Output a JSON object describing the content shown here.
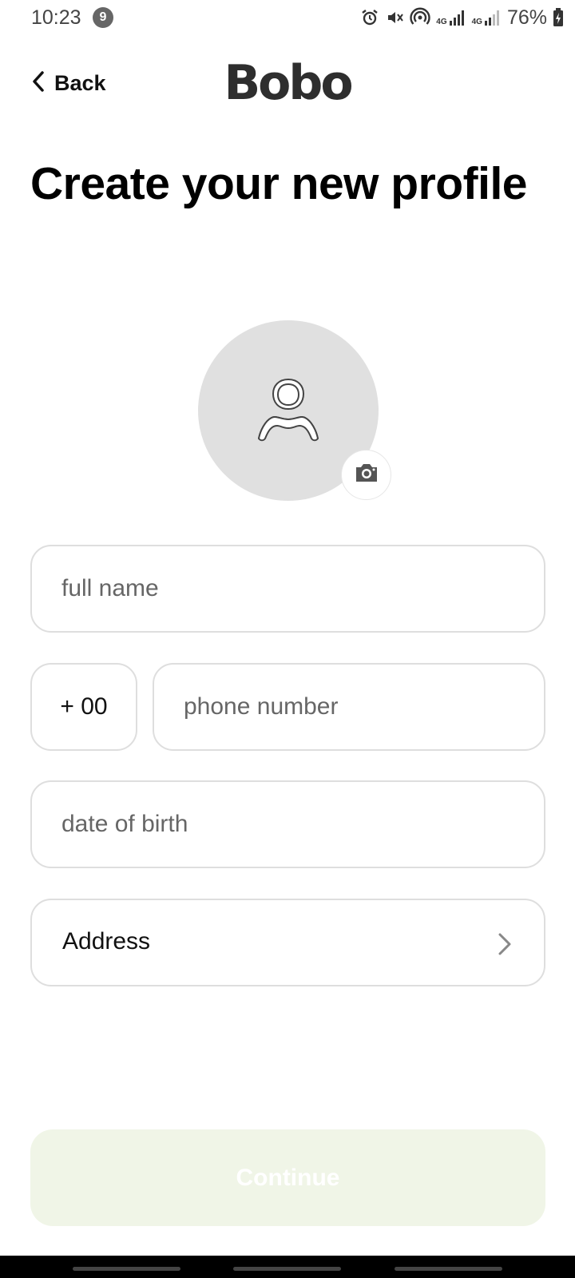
{
  "status_bar": {
    "time": "10:23",
    "notification_count": "9",
    "network_1": "4G",
    "network_2": "4G",
    "battery": "76%",
    "icons": [
      "alarm-icon",
      "vibrate-mute-icon",
      "hotspot-icon",
      "signal-icon",
      "signal-icon",
      "battery-charging-icon"
    ]
  },
  "header": {
    "back_label": "Back",
    "logo": "Bobo"
  },
  "title": "Create your new profile",
  "avatar": {
    "icon": "person-icon",
    "camera_icon": "camera-icon"
  },
  "form": {
    "full_name": {
      "value": "",
      "placeholder": "full name"
    },
    "country_code": "+ 00",
    "phone": {
      "value": "",
      "placeholder": "phone number"
    },
    "date_of_birth": {
      "value": "",
      "placeholder": "date of birth"
    },
    "address_label": "Address"
  },
  "continue_label": "Continue",
  "colors": {
    "continue_bg": "#f0f5e7",
    "logo": "#2e2e2e",
    "avatar_bg": "#e0e0e0",
    "field_border": "#dedede"
  }
}
